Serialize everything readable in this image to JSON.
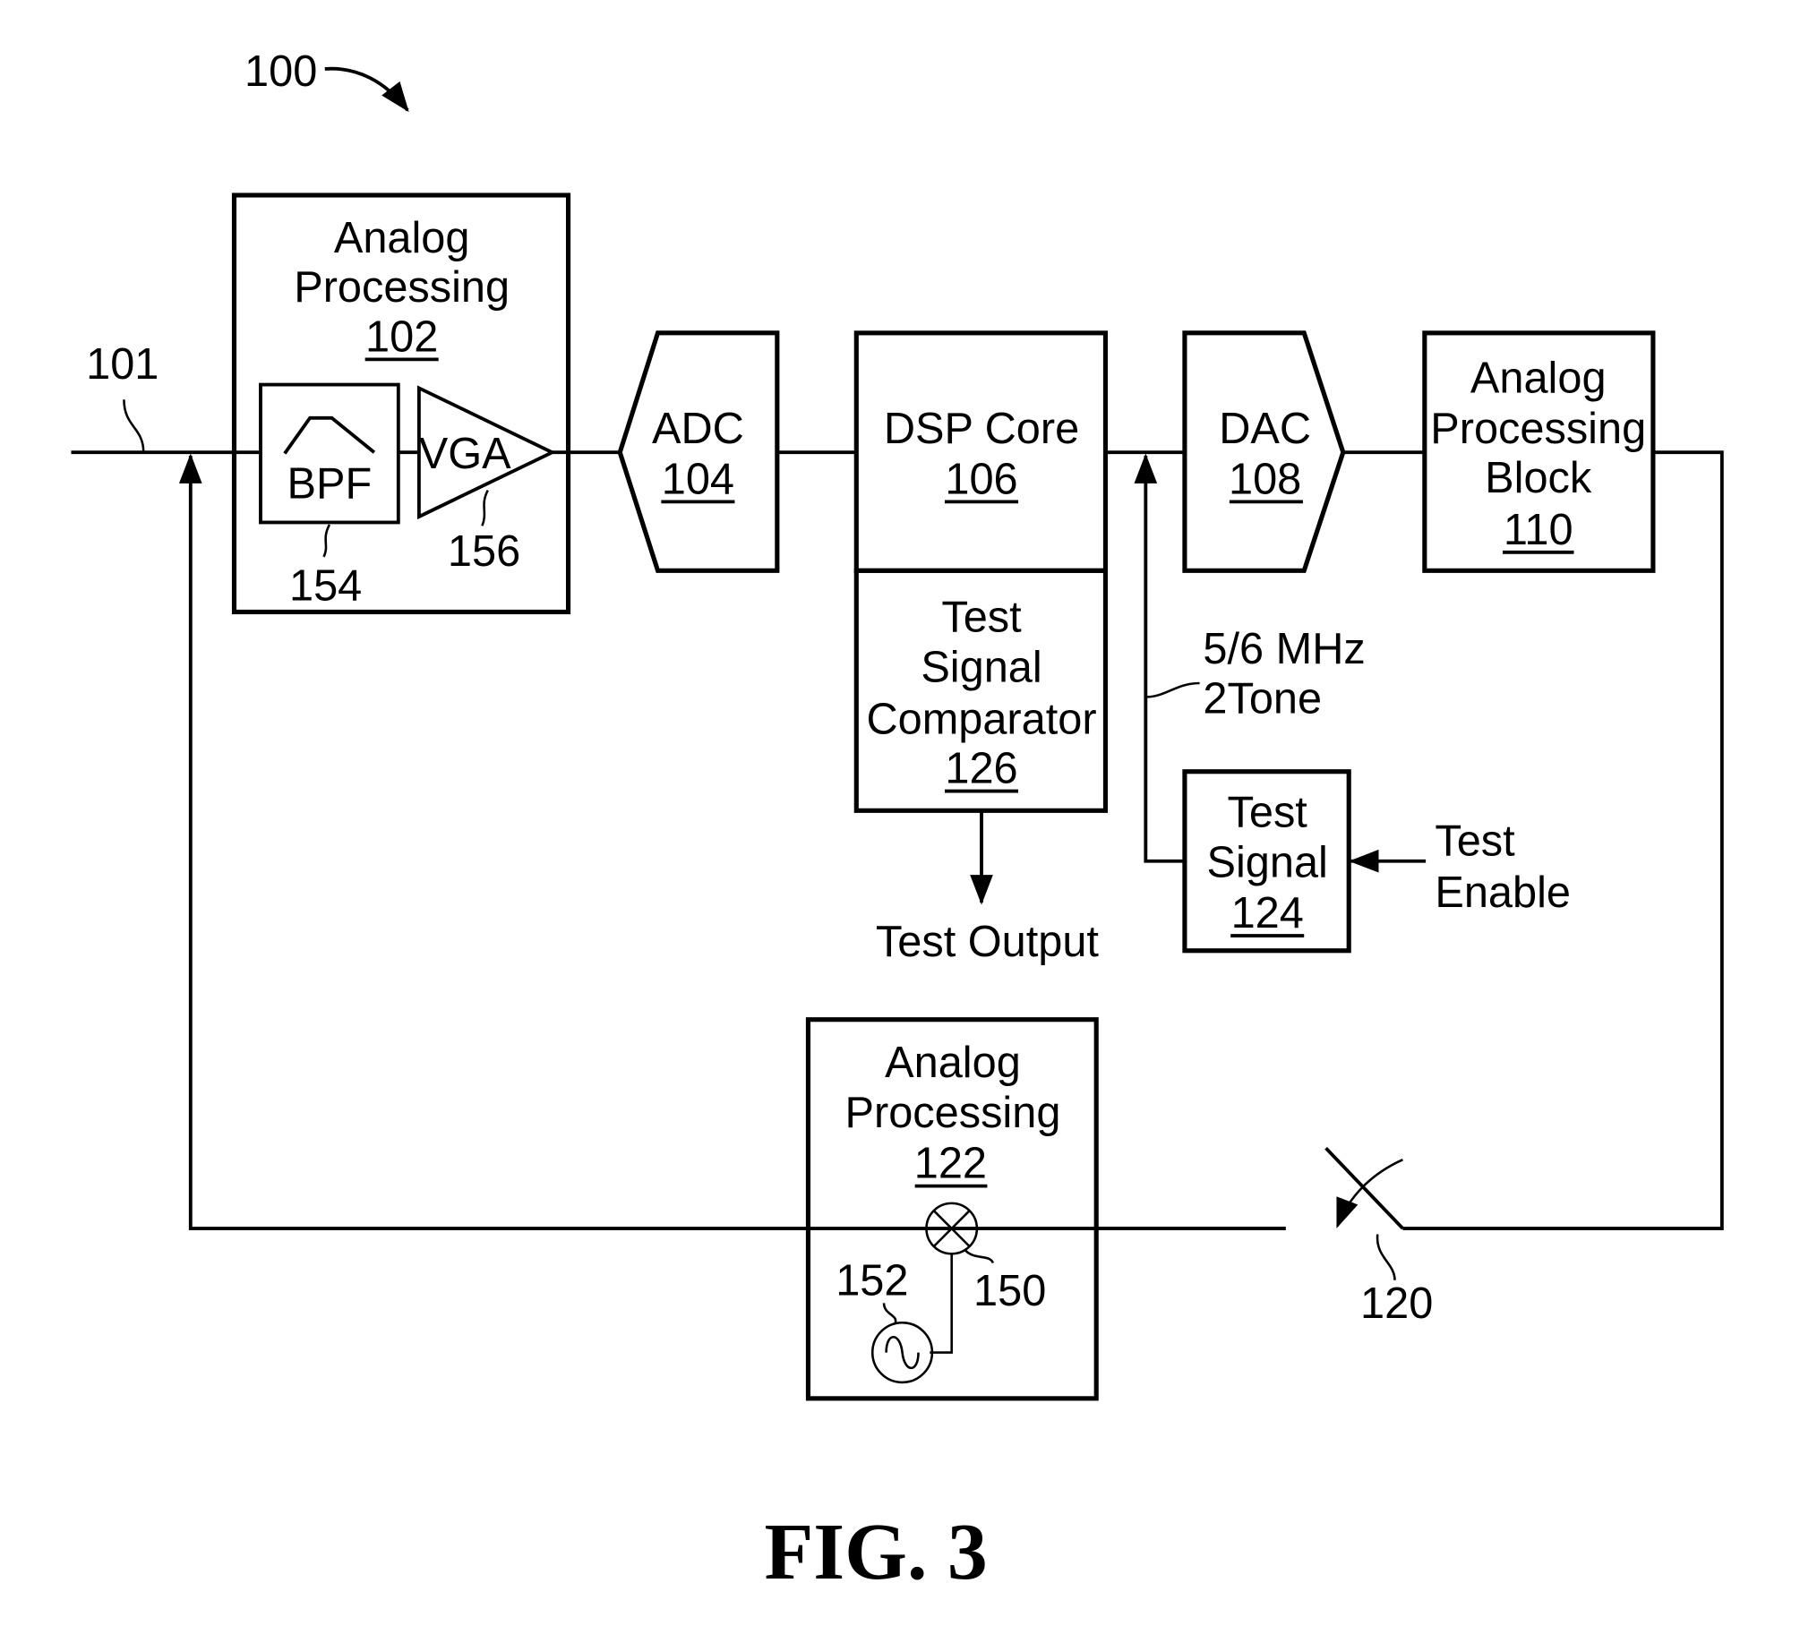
{
  "figure": {
    "number_label": "FIG. 3",
    "system_ref": "100",
    "input_ref": "101"
  },
  "blocks": {
    "analog_102": {
      "lines": [
        "Analog",
        "Processing"
      ],
      "ref": "102"
    },
    "bpf": {
      "label": "BPF",
      "ref": "154"
    },
    "vga": {
      "label": "VGA",
      "ref": "156"
    },
    "adc": {
      "label": "ADC",
      "ref": "104"
    },
    "dsp": {
      "label": "DSP Core",
      "ref": "106"
    },
    "comparator": {
      "lines": [
        "Test",
        "Signal",
        "Comparator"
      ],
      "ref": "126"
    },
    "dac": {
      "label": "DAC",
      "ref": "108"
    },
    "analog_110": {
      "lines": [
        "Analog",
        "Processing",
        "Block"
      ],
      "ref": "110"
    },
    "test_signal": {
      "lines": [
        "Test",
        "Signal"
      ],
      "ref": "124"
    },
    "analog_122": {
      "lines": [
        "Analog",
        "Processing"
      ],
      "ref": "122"
    },
    "mixer": {
      "ref": "150"
    },
    "oscillator": {
      "ref": "152"
    },
    "switch": {
      "ref": "120"
    }
  },
  "annotations": {
    "test_output": "Test Output",
    "tone_line1": "5/6 MHz",
    "tone_line2": "2Tone",
    "test_enable_line1": "Test",
    "test_enable_line2": "Enable"
  }
}
